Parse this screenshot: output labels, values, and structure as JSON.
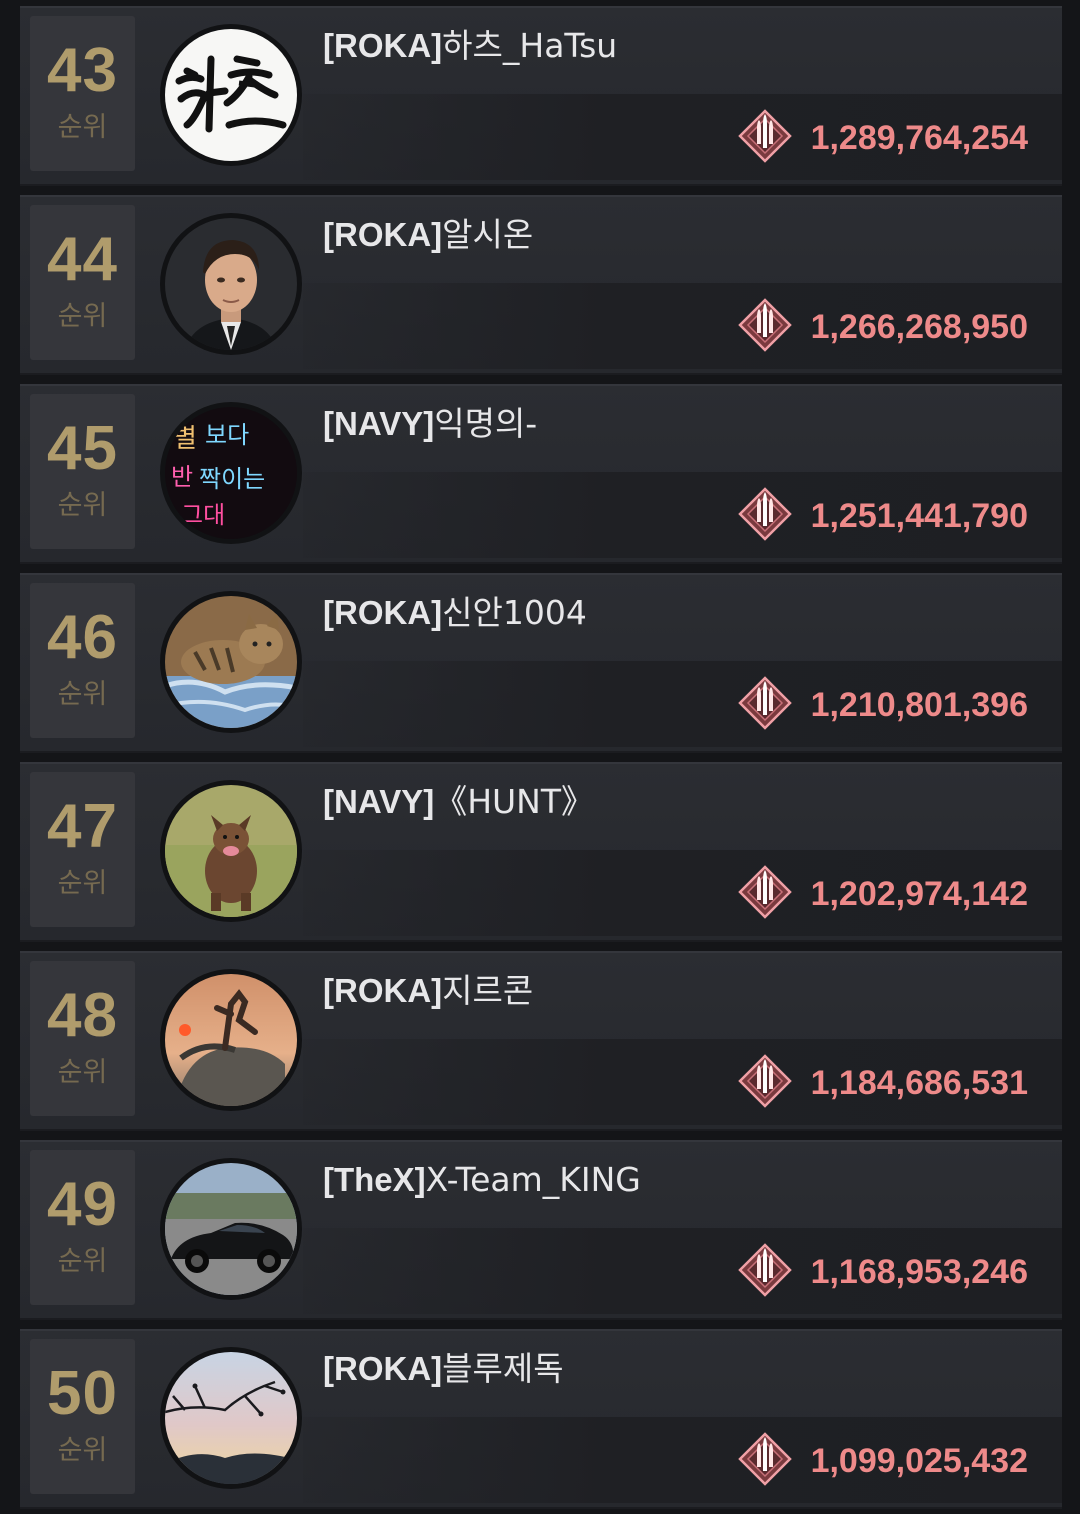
{
  "rank_suffix": "순위",
  "colors": {
    "rank": "#b09c6c",
    "score": "#ee8a8a",
    "row_bg": "#2b2d32",
    "page_bg": "#141518"
  },
  "entries": [
    {
      "rank": "43",
      "rank_label": "순위",
      "clan": "[ROKA]",
      "name": "하츠_HaTsu",
      "score": "1,289,764,254",
      "avatar": "calligraphy-avatar"
    },
    {
      "rank": "44",
      "rank_label": "순위",
      "clan": "[ROKA]",
      "name": "알시온",
      "score": "1,266,268,950",
      "avatar": "man-portrait-avatar"
    },
    {
      "rank": "45",
      "rank_label": "순위",
      "clan": "[NAVY]",
      "name": "익명의-",
      "score": "1,251,441,790",
      "avatar": "neon-sign-avatar"
    },
    {
      "rank": "46",
      "rank_label": "순위",
      "clan": "[ROKA]",
      "name": "신안1004",
      "score": "1,210,801,396",
      "avatar": "cat-avatar"
    },
    {
      "rank": "47",
      "rank_label": "순위",
      "clan": "[NAVY]",
      "name": "《HUNT》",
      "score": "1,202,974,142",
      "avatar": "dog-avatar"
    },
    {
      "rank": "48",
      "rank_label": "순위",
      "clan": "[ROKA]",
      "name": "지르콘",
      "score": "1,184,686,531",
      "avatar": "statue-sunset-avatar"
    },
    {
      "rank": "49",
      "rank_label": "순위",
      "clan": "[TheX]",
      "name": "X-Team_KING",
      "score": "1,168,953,246",
      "avatar": "sports-car-avatar"
    },
    {
      "rank": "50",
      "rank_label": "순위",
      "clan": "[ROKA]",
      "name": "블루제독",
      "score": "1,099,025,432",
      "avatar": "dusk-branches-avatar"
    }
  ]
}
